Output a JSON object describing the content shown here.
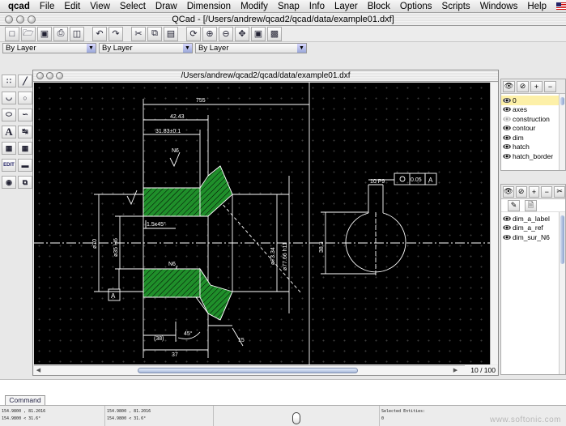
{
  "menubar": {
    "app": "qcad",
    "items": [
      "File",
      "Edit",
      "View",
      "Select",
      "Draw",
      "Dimension",
      "Modify",
      "Snap",
      "Info",
      "Layer",
      "Block",
      "Options",
      "Scripts",
      "Windows",
      "Help"
    ]
  },
  "window": {
    "title": "QCad - [/Users/andrew/qcad2/qcad/data/example01.dxf]"
  },
  "toolbar": {
    "buttons": [
      "new-icon",
      "open-icon",
      "save-icon",
      "print-icon",
      "print-preview-icon",
      "undo-icon",
      "redo-icon",
      "cut-icon",
      "copy-icon",
      "paste-icon",
      "redraw-icon",
      "zoom-in-icon",
      "zoom-out-icon",
      "zoom-auto-icon",
      "zoom-window-icon",
      "zoom-pan-icon"
    ]
  },
  "combos": {
    "pen_color": "By Layer",
    "pen_width": "By Layer",
    "line_type": "By Layer"
  },
  "palette": {
    "buttons": [
      "points-icon",
      "lines-icon",
      "arcs-icon",
      "circles-icon",
      "ellipses-icon",
      "splines-icon",
      "text-icon",
      "dimensions-icon",
      "hatch-icon",
      "image-icon",
      "edit-icon",
      "measure-icon",
      "select-icon",
      "block-icon"
    ],
    "edit_label": "EDIT"
  },
  "document": {
    "title": "/Users/andrew/qcad2/qcad/data/example01.dxf",
    "page_info": "10 / 100",
    "drawing_labels": {
      "d755": "755",
      "d4243": "42.43",
      "d3183": "31.83±0.1",
      "n6a": "N6",
      "n6b": "N6",
      "chamfer": "1.5x45°",
      "d70": "ø70",
      "d35": "ø35 H6",
      "da": "A",
      "d38": "(38)",
      "d45": "45°",
      "d37": "37",
      "d15": "15",
      "d7334": "ø73.34",
      "d7766": "ø77.66 h11",
      "p9": "10 P9",
      "tol": "0.05",
      "ref": "A",
      "d383": "38.3"
    }
  },
  "layers": {
    "items": [
      {
        "name": "0",
        "active": true,
        "visible": true
      },
      {
        "name": "axes",
        "active": false,
        "visible": true
      },
      {
        "name": "construction",
        "active": false,
        "visible": false
      },
      {
        "name": "contour",
        "active": false,
        "visible": true
      },
      {
        "name": "dim",
        "active": false,
        "visible": true
      },
      {
        "name": "hatch",
        "active": false,
        "visible": true
      },
      {
        "name": "hatch_border",
        "active": false,
        "visible": true
      }
    ]
  },
  "blocks": {
    "items": [
      "dim_a_label",
      "dim_a_ref",
      "dim_sur_N6"
    ]
  },
  "command": {
    "tab_label": "Command"
  },
  "status": {
    "abs_line1": "154.9800 , 81.2016",
    "abs_line2": "154.9800 < 31.6°",
    "rel_line1": "154.9800 , 81.2016",
    "rel_line2": "154.9800 < 31.6°",
    "selected_label": "Selected Entities:",
    "selected_value": "0"
  },
  "watermark": "www.softonic.com"
}
